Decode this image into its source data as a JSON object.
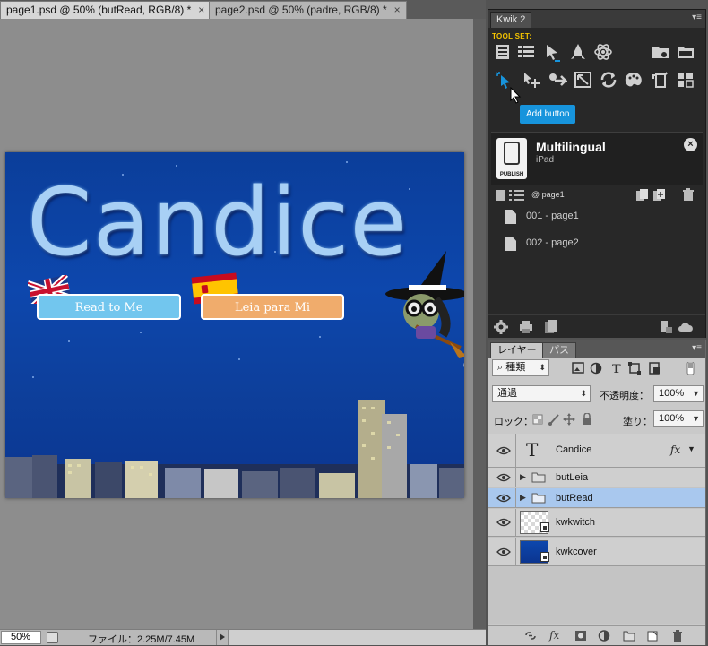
{
  "document": {
    "tabs": [
      {
        "label": "page1.psd @ 50% (butRead, RGB/8) *",
        "close": "×",
        "active": true
      },
      {
        "label": "page2.psd @ 50% (padre, RGB/8) *",
        "close": "×",
        "active": false
      }
    ],
    "artwork": {
      "title": "Candice",
      "buttons": {
        "read": "Read to Me",
        "leia": "Leia para Mi"
      }
    },
    "status": {
      "zoom": "50%",
      "file_info": "ファイル：2.25M/7.45M"
    }
  },
  "kwik": {
    "tab": "Kwik 2",
    "toolset_label": "TOOL SET:",
    "tooltip": "Add button",
    "project": {
      "title": "Multilingual",
      "device": "iPad",
      "publish_label": "PUBLISH"
    },
    "current_page": "@ page1",
    "pages": [
      {
        "label": "001 - page1"
      },
      {
        "label": "002 - page2"
      }
    ],
    "accent_color": "#f5c400",
    "tooltip_color": "#1794dc"
  },
  "layers": {
    "tabs": {
      "layers": "レイヤー",
      "paths": "パス"
    },
    "filter_kind": "種類",
    "blend_mode": "通過",
    "opacity_label": "不透明度：",
    "opacity_value": "100%",
    "lock_label": "ロック：",
    "fill_label": "塗り：",
    "fill_value": "100%",
    "items": [
      {
        "name": "Candice",
        "type": "text",
        "fx": "fx"
      },
      {
        "name": "butLeia",
        "type": "group"
      },
      {
        "name": "butRead",
        "type": "group",
        "selected": true
      },
      {
        "name": "kwkwitch",
        "type": "smart-object"
      },
      {
        "name": "kwkcover",
        "type": "smart-object"
      }
    ],
    "selection_color": "#a9c8ee"
  }
}
